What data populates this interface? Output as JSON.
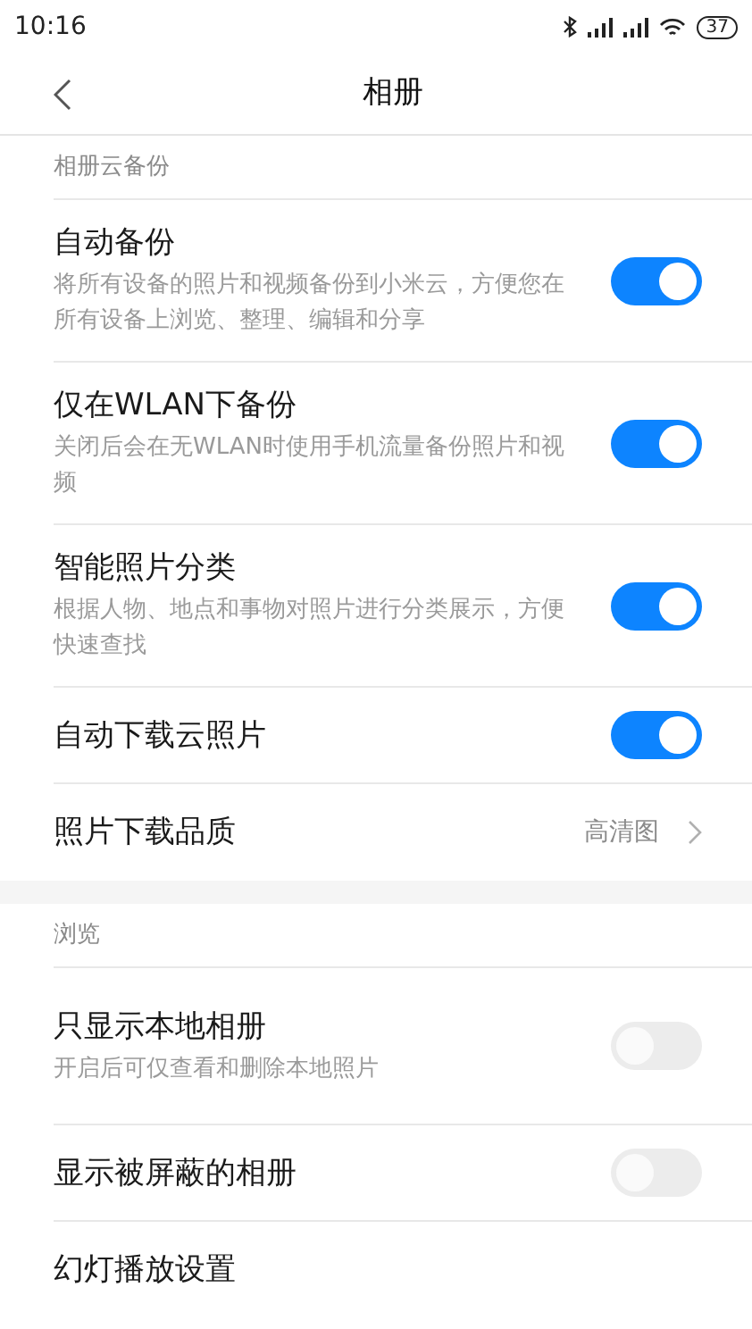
{
  "status_bar": {
    "time": "10:16",
    "battery": "37"
  },
  "header": {
    "title": "相册"
  },
  "sections": [
    {
      "header": "相册云备份",
      "items": [
        {
          "kind": "toggle",
          "title": "自动备份",
          "subtitle": "将所有设备的照片和视频备份到小米云，方便您在所有设备上浏览、整理、编辑和分享",
          "on": true
        },
        {
          "kind": "toggle",
          "title": "仅在WLAN下备份",
          "subtitle": "关闭后会在无WLAN时使用手机流量备份照片和视频",
          "on": true
        },
        {
          "kind": "toggle",
          "title": "智能照片分类",
          "subtitle": "根据人物、地点和事物对照片进行分类展示，方便快速查找",
          "on": true
        },
        {
          "kind": "toggle",
          "title": "自动下载云照片",
          "on": true
        },
        {
          "kind": "value",
          "title": "照片下载品质",
          "value": "高清图"
        }
      ]
    },
    {
      "header": "浏览",
      "items": [
        {
          "kind": "toggle",
          "title": "只显示本地相册",
          "subtitle": "开启后可仅查看和删除本地照片",
          "on": false
        },
        {
          "kind": "toggle",
          "title": "显示被屏蔽的相册",
          "on": false
        },
        {
          "kind": "link",
          "title": "幻灯播放设置"
        }
      ]
    }
  ]
}
